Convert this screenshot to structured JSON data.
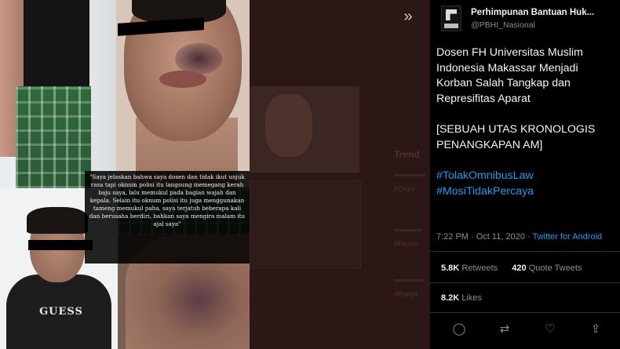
{
  "collage": {
    "shirt_brand": "GUESS",
    "quote": "\"Saya jelaskan bahwa saya dosen dan tidak ikut unjuk rasa tapi oknum polisi itu langsung memegang kerah baju saya, lalu memukul pada bagian wajah dan kepala. Selain itu oknum polisi itu juga menggunakan tameng memukul paha, saya terjatuh beberapa kali dan berusaha berdiri, bahkan saya mengira malam itu ajal saya\""
  },
  "backdrop": {
    "trending_label": "Trend",
    "items": [
      "#Omni",
      "#Rezim",
      "#Rakya"
    ]
  },
  "nav": {
    "collapse_icon": "double-chevron-right-icon",
    "collapse_glyph": "»"
  },
  "tweet": {
    "author_name": "Perhimpunan Bantuan Huk...",
    "author_handle": "@PBHI_Nasional",
    "text_line1": "Dosen FH Universitas Muslim Indonesia Makassar Menjadi Korban Salah Tangkap dan Represifitas Aparat",
    "text_line2": "[SEBUAH UTAS KRONOLOGIS PENANGKAPAN AM]",
    "hashtag1": "#TolakOmnibusLaw",
    "hashtag2": "#MosiTidakPercaya",
    "timestamp": "7:22 PM · Oct 11, 2020 · ",
    "source": "Twitter for Android",
    "retweets_count": "5.8K",
    "retweets_label": "Retweets",
    "quotes_count": "420",
    "quotes_label": "Quote Tweets",
    "likes_count": "8.2K",
    "likes_label": "Likes",
    "actions": {
      "reply_glyph": "◯",
      "retweet_glyph": "⇄",
      "like_glyph": "♡",
      "share_glyph": "⇪"
    }
  },
  "colors": {
    "link": "#1d9bf0",
    "background": "#000000",
    "muted_text": "#8a8f94",
    "backdrop": "#2c1717"
  }
}
